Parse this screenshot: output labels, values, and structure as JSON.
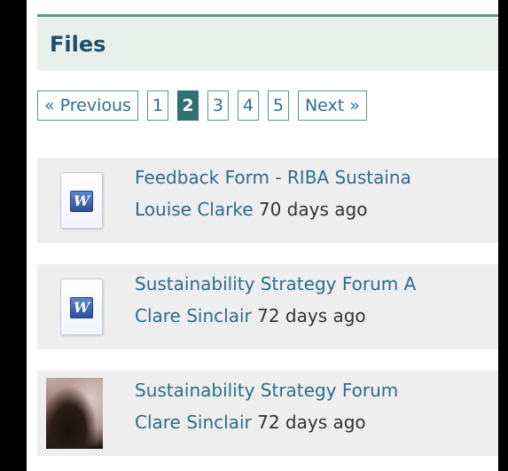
{
  "header": {
    "title": "Files"
  },
  "pager": {
    "previous": "« Previous",
    "pages": [
      "1",
      "2",
      "3",
      "4",
      "5"
    ],
    "current": "2",
    "next": "Next »"
  },
  "files": [
    {
      "name": "Feedback Form - RIBA Sustaina",
      "author": "Louise Clarke",
      "age": "70 days ago",
      "icon": "word-document-icon"
    },
    {
      "name": "Sustainability Strategy Forum A",
      "author": "Clare Sinclair",
      "age": "72 days ago",
      "icon": "word-document-icon"
    },
    {
      "name": "Sustainability Strategy Forum",
      "author": "Clare Sinclair",
      "age": "72 days ago",
      "icon": "photo-thumbnail"
    }
  ]
}
